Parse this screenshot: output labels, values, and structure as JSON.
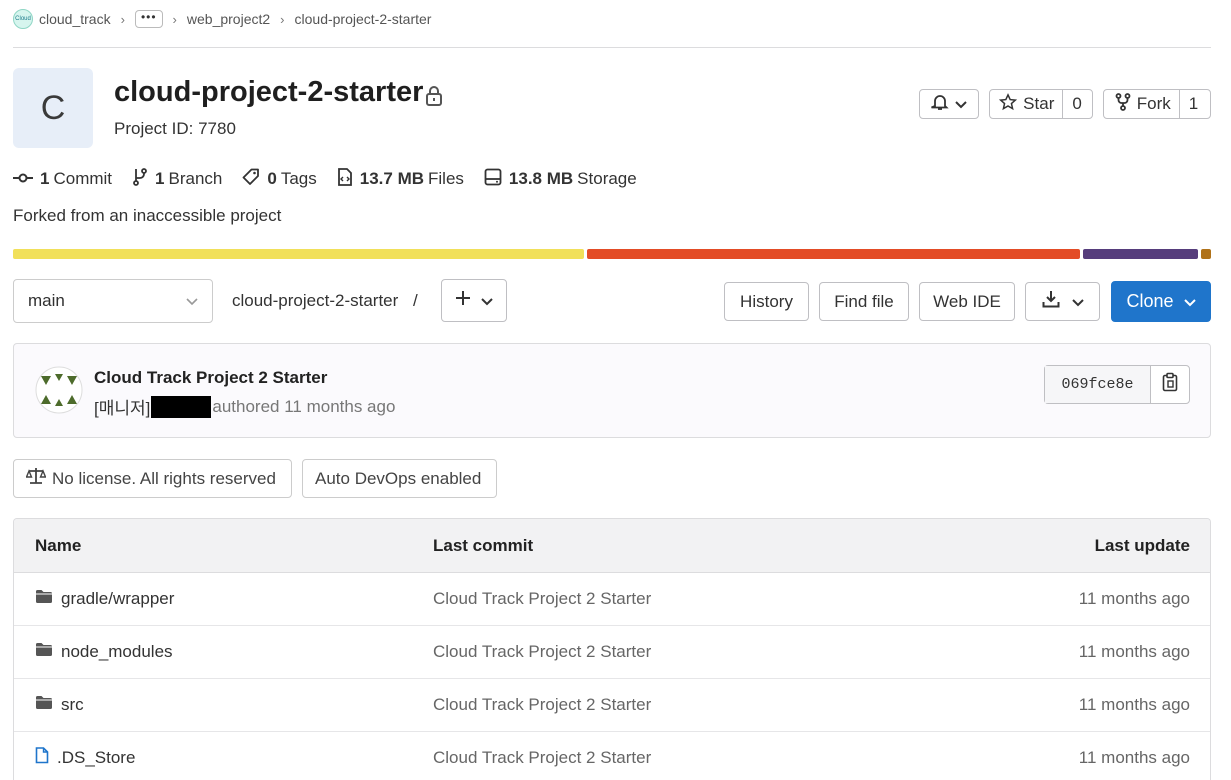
{
  "breadcrumb": {
    "logo_text": "Cloud",
    "items": [
      "cloud_track",
      "web_project2",
      "cloud-project-2-starter"
    ],
    "more": "•••"
  },
  "project": {
    "avatar_letter": "C",
    "name": "cloud-project-2-starter",
    "id_label": "Project ID: 7780"
  },
  "actions": {
    "star_label": "Star",
    "star_count": "0",
    "fork_label": "Fork",
    "fork_count": "1"
  },
  "stats": {
    "commits_num": "1",
    "commits_label": "Commit",
    "branches_num": "1",
    "branches_label": "Branch",
    "tags_num": "0",
    "tags_label": "Tags",
    "files_num": "13.7 MB",
    "files_label": "Files",
    "storage_num": "13.8 MB",
    "storage_label": "Storage"
  },
  "forked_text": "Forked from an inaccessible project",
  "languages": [
    {
      "percent": 47.8,
      "color": "#f1e05a"
    },
    {
      "percent": 41.2,
      "color": "#e34c26"
    },
    {
      "percent": 9.7,
      "color": "#563d7c"
    },
    {
      "percent": 0.8,
      "color": "#b07219"
    }
  ],
  "toolbar": {
    "branch": "main",
    "path": "cloud-project-2-starter",
    "path_sep": "/",
    "history": "History",
    "find_file": "Find file",
    "web_ide": "Web IDE",
    "clone": "Clone"
  },
  "last_commit": {
    "title": "Cloud Track Project 2 Starter",
    "author_prefix": "[매니저]",
    "authored": "authored 11 months ago",
    "sha": "069fce8e"
  },
  "badges": {
    "license": "No license. All rights reserved",
    "devops": "Auto DevOps enabled"
  },
  "table": {
    "headers": {
      "name": "Name",
      "last_commit": "Last commit",
      "last_update": "Last update"
    },
    "rows": [
      {
        "name": "gradle/wrapper",
        "type": "folder",
        "commit": "Cloud Track Project 2 Starter",
        "updated": "11 months ago"
      },
      {
        "name": "node_modules",
        "type": "folder",
        "commit": "Cloud Track Project 2 Starter",
        "updated": "11 months ago"
      },
      {
        "name": "src",
        "type": "folder",
        "commit": "Cloud Track Project 2 Starter",
        "updated": "11 months ago"
      },
      {
        "name": ".DS_Store",
        "type": "file",
        "commit": "Cloud Track Project 2 Starter",
        "updated": "11 months ago"
      }
    ]
  },
  "colors": {
    "accent": "#1f75cb",
    "folder_icon": "#555555",
    "file_icon": "#1f75cb"
  }
}
